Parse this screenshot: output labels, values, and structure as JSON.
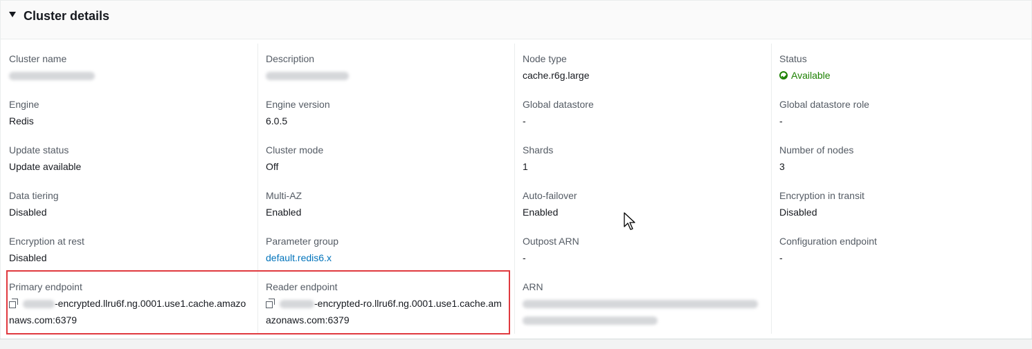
{
  "panel": {
    "title": "Cluster details"
  },
  "columns": [
    {
      "fields": [
        {
          "label": "Cluster name",
          "value": ""
        },
        {
          "label": "Engine",
          "value": "Redis"
        },
        {
          "label": "Update status",
          "value": "Update available"
        },
        {
          "label": "Data tiering",
          "value": "Disabled"
        },
        {
          "label": "Encryption at rest",
          "value": "Disabled"
        }
      ]
    },
    {
      "fields": [
        {
          "label": "Description",
          "value": ""
        },
        {
          "label": "Engine version",
          "value": "6.0.5"
        },
        {
          "label": "Cluster mode",
          "value": "Off"
        },
        {
          "label": "Multi-AZ",
          "value": "Enabled"
        },
        {
          "label": "Parameter group",
          "value": "default.redis6.x"
        }
      ]
    },
    {
      "fields": [
        {
          "label": "Node type",
          "value": "cache.r6g.large"
        },
        {
          "label": "Global datastore",
          "value": "-"
        },
        {
          "label": "Shards",
          "value": "1"
        },
        {
          "label": "Auto-failover",
          "value": "Enabled"
        },
        {
          "label": "Outpost ARN",
          "value": "-"
        }
      ]
    },
    {
      "fields": [
        {
          "label": "Status",
          "value": "Available"
        },
        {
          "label": "Global datastore role",
          "value": "-"
        },
        {
          "label": "Number of nodes",
          "value": "3"
        },
        {
          "label": "Encryption in transit",
          "value": "Disabled"
        },
        {
          "label": "Configuration endpoint",
          "value": "-"
        }
      ]
    }
  ],
  "endpoints": {
    "primary": {
      "label": "Primary endpoint",
      "value_visible": "-encrypted.llru6f.ng.0001.use1.cache.amazonaws.com:6379"
    },
    "reader": {
      "label": "Reader endpoint",
      "value_visible": "-encrypted-ro.llru6f.ng.0001.use1.cache.amazonaws.com:6379"
    },
    "arn": {
      "label": "ARN"
    }
  },
  "colors": {
    "status_available": "#1d8102",
    "link": "#0073bb",
    "highlight": "#e0393e"
  },
  "icons": {
    "caret": "caret-down-icon",
    "status": "check-circle-icon",
    "copy": "copy-icon"
  }
}
